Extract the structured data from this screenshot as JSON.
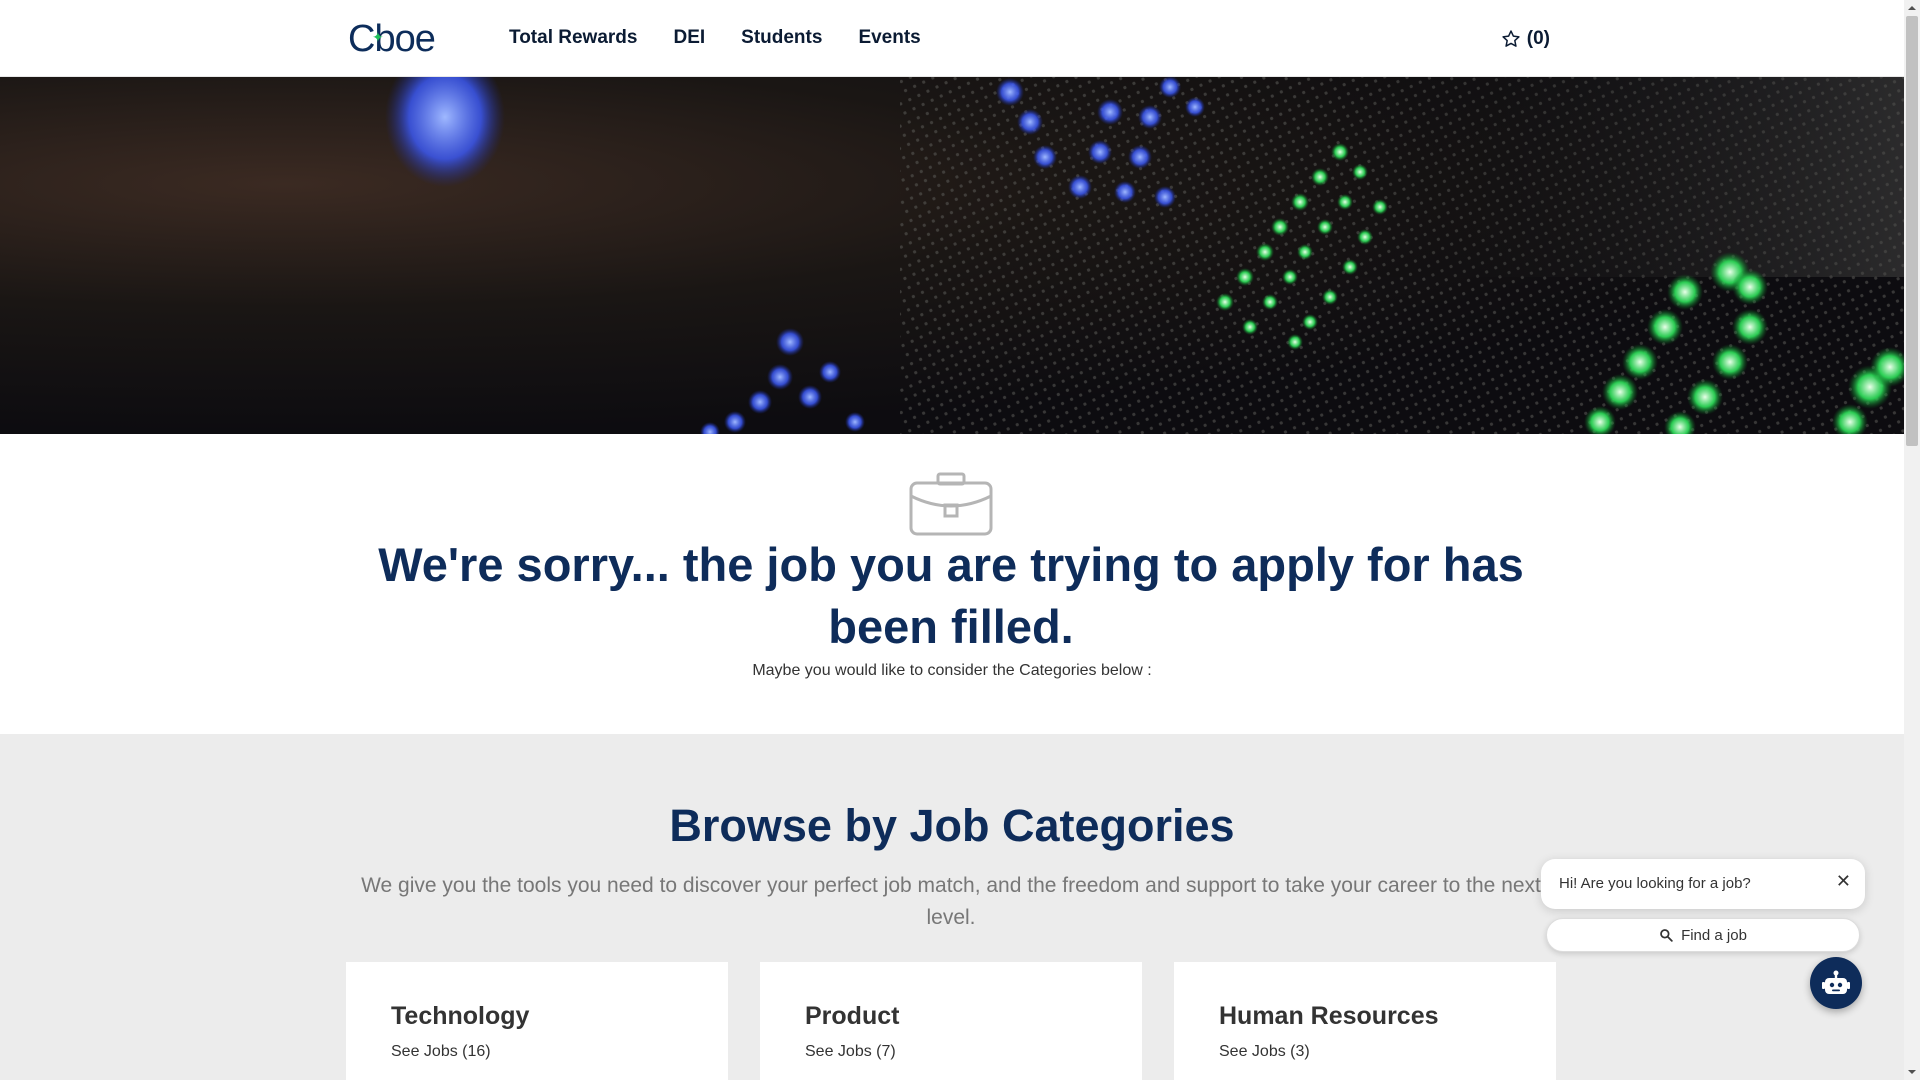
{
  "header": {
    "logo_text": "Cboe",
    "nav": [
      {
        "label": "Total Rewards"
      },
      {
        "label": "DEI"
      },
      {
        "label": "Students"
      },
      {
        "label": "Events"
      }
    ],
    "favorites_label": "(0)"
  },
  "message": {
    "title": "We're sorry... the job you are trying to apply for has been filled.",
    "subtitle": "Maybe you would like to consider the Categories below :"
  },
  "browse": {
    "title": "Browse by Job Categories",
    "intro": "We give you the tools you need to discover your perfect job match, and the freedom and support to take your career to the next level.",
    "categories": [
      {
        "name": "Technology",
        "link": "See Jobs (16)"
      },
      {
        "name": "Product",
        "link": "See Jobs (7)"
      },
      {
        "name": "Human Resources",
        "link": "See Jobs (3)"
      }
    ]
  },
  "chat": {
    "greeting": "Hi! Are you looking for a job?",
    "button_label": "Find a job",
    "close_symbol": "✕"
  },
  "colors": {
    "brand_navy": "#0e2c5a",
    "brand_green": "#1fbf5a",
    "section_gray": "#ececec"
  }
}
